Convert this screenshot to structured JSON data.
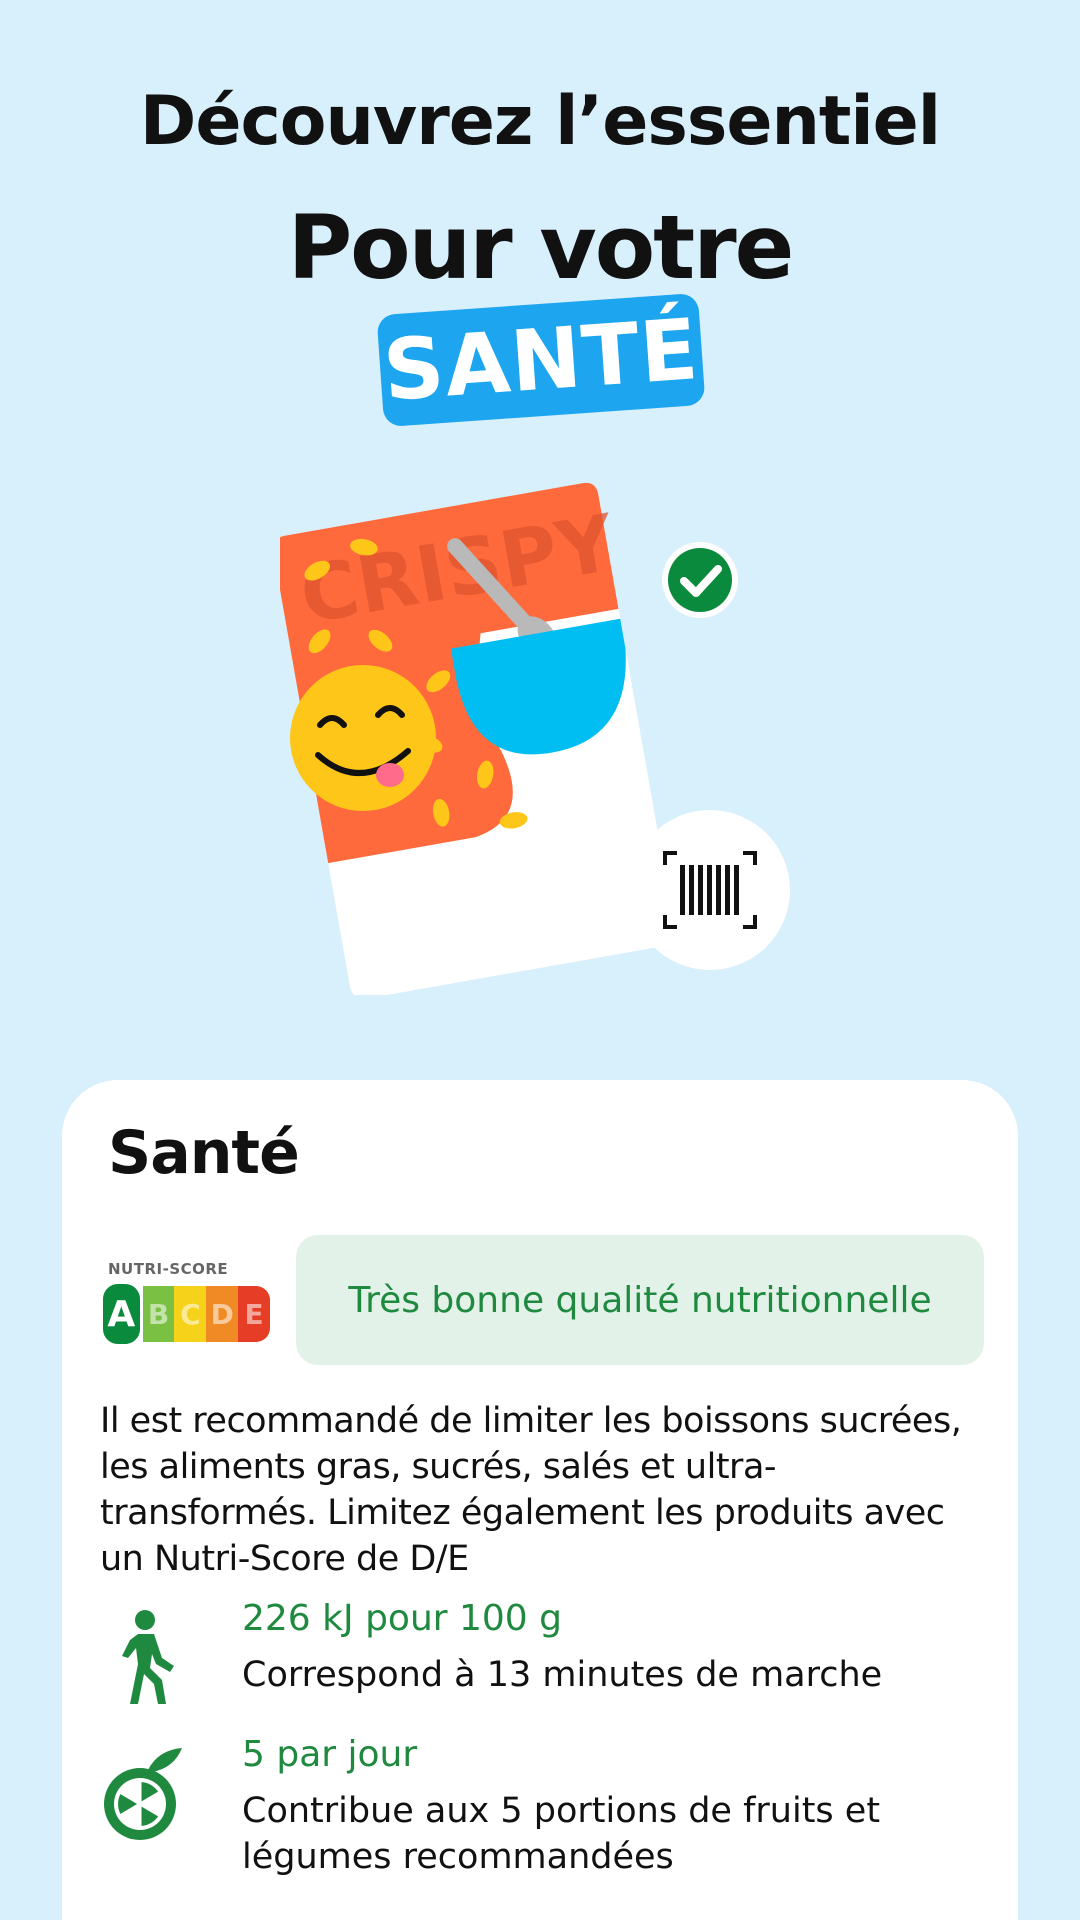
{
  "headline": "Découvrez l’essentiel",
  "subheadline": "Pour votre",
  "badge": "SANTÉ",
  "illustration": {
    "package_text": "CRISPY",
    "icons": [
      "cereal-box-illustration",
      "smiley-emoji-icon",
      "check-badge-icon",
      "barcode-scan-icon",
      "spoon-icon",
      "bowl-icon"
    ]
  },
  "card": {
    "title": "Santé",
    "nutriscore": {
      "label": "NUTRI-SCORE",
      "grades": [
        "A",
        "B",
        "C",
        "D",
        "E"
      ],
      "selected": "A",
      "colors": [
        "#0a8a3c",
        "#7ac143",
        "#f7d21a",
        "#f08a24",
        "#e63d26"
      ]
    },
    "quality_text": "Très bonne qualité nutritionnelle",
    "advice": "Il est recommandé de limiter les boissons sucrées, les aliments gras, sucrés, salés et ultra-transformés. Limitez également les produits avec un Nutri-Score de D/E",
    "facts": [
      {
        "icon": "walking-person-icon",
        "title": "226 kJ pour 100 g",
        "description": "Correspond à 13 minutes de marche"
      },
      {
        "icon": "citrus-fruit-icon",
        "title": "5 par jour",
        "description": "Contribue aux 5 portions de fruits et légumes recommandées"
      }
    ]
  },
  "colors": {
    "background": "#d8effc",
    "accent_blue": "#1da6ef",
    "green": "#1f8a3f",
    "green_bg": "#e3f2e8",
    "box_orange": "#ff6a3d",
    "bowl_blue": "#00bdf2"
  }
}
